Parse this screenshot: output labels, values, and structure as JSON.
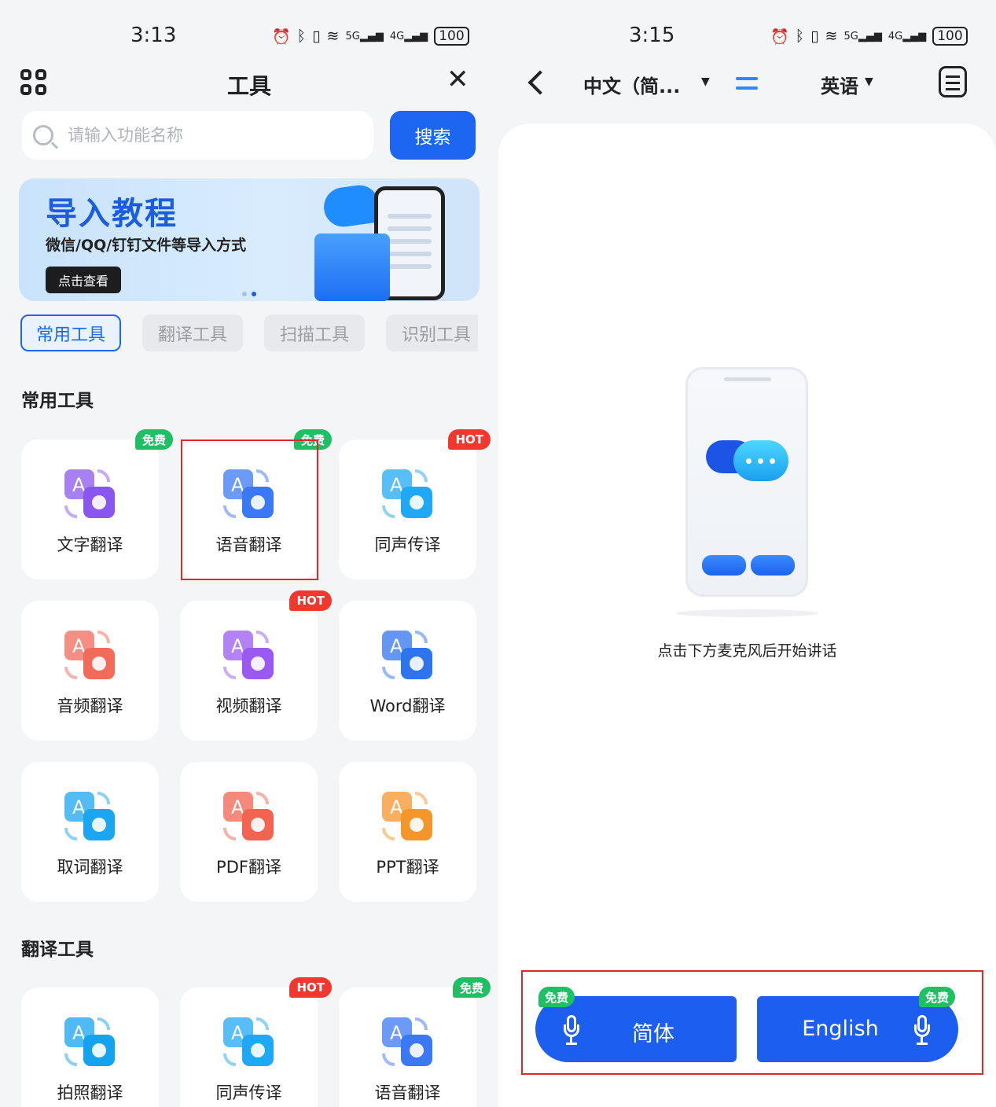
{
  "left": {
    "status": {
      "time": "3:13",
      "signal_5g": "5G",
      "signal_4g": "4G",
      "battery": "100"
    },
    "header": {
      "title": "工具"
    },
    "search": {
      "placeholder": "请输入功能名称",
      "button": "搜索"
    },
    "banner": {
      "title": "导入教程",
      "subtitle": "微信/QQ/钉钉文件等导入方式",
      "button": "点击查看"
    },
    "tabs": [
      "常用工具",
      "翻译工具",
      "扫描工具",
      "识别工具"
    ],
    "sections": [
      {
        "title": "常用工具",
        "items": [
          {
            "label": "文字翻译",
            "badge": "免费",
            "badge_type": "free",
            "color": "#8a56f0"
          },
          {
            "label": "语音翻译",
            "badge": "免费",
            "badge_type": "free",
            "color": "#3b78f5"
          },
          {
            "label": "同声传译",
            "badge": "HOT",
            "badge_type": "hot",
            "color": "#1fa8f5"
          },
          {
            "label": "音频翻译",
            "badge": "",
            "badge_type": "",
            "color": "#f26a5a"
          },
          {
            "label": "视频翻译",
            "badge": "HOT",
            "badge_type": "hot",
            "color": "#9a5af2"
          },
          {
            "label": "Word翻译",
            "badge": "",
            "badge_type": "",
            "color": "#2f74ef"
          },
          {
            "label": "取词翻译",
            "badge": "",
            "badge_type": "",
            "color": "#1aa6f0"
          },
          {
            "label": "PDF翻译",
            "badge": "",
            "badge_type": "",
            "color": "#f26350"
          },
          {
            "label": "PPT翻译",
            "badge": "",
            "badge_type": "",
            "color": "#f5962b"
          }
        ]
      },
      {
        "title": "翻译工具",
        "items": [
          {
            "label": "拍照翻译",
            "badge": "",
            "badge_type": "",
            "color": "#14a3ef"
          },
          {
            "label": "同声传译",
            "badge": "HOT",
            "badge_type": "hot",
            "color": "#1fa8f5"
          },
          {
            "label": "语音翻译",
            "badge": "免费",
            "badge_type": "free",
            "color": "#3b78f5"
          }
        ]
      }
    ]
  },
  "right": {
    "status": {
      "time": "3:15",
      "signal_5g": "5G",
      "signal_4g": "4G",
      "battery": "100"
    },
    "header": {
      "source_lang": "中文（简...",
      "target_lang": "英语"
    },
    "hint": "点击下方麦克风后开始讲话",
    "mic_left": {
      "label": "简体",
      "badge": "免费"
    },
    "mic_right": {
      "label": "English",
      "badge": "免费"
    }
  },
  "colors": {
    "accent": "#1c66f2",
    "free_badge": "#1fbf66",
    "hot_badge": "#f2372e",
    "highlight": "#e02828"
  }
}
